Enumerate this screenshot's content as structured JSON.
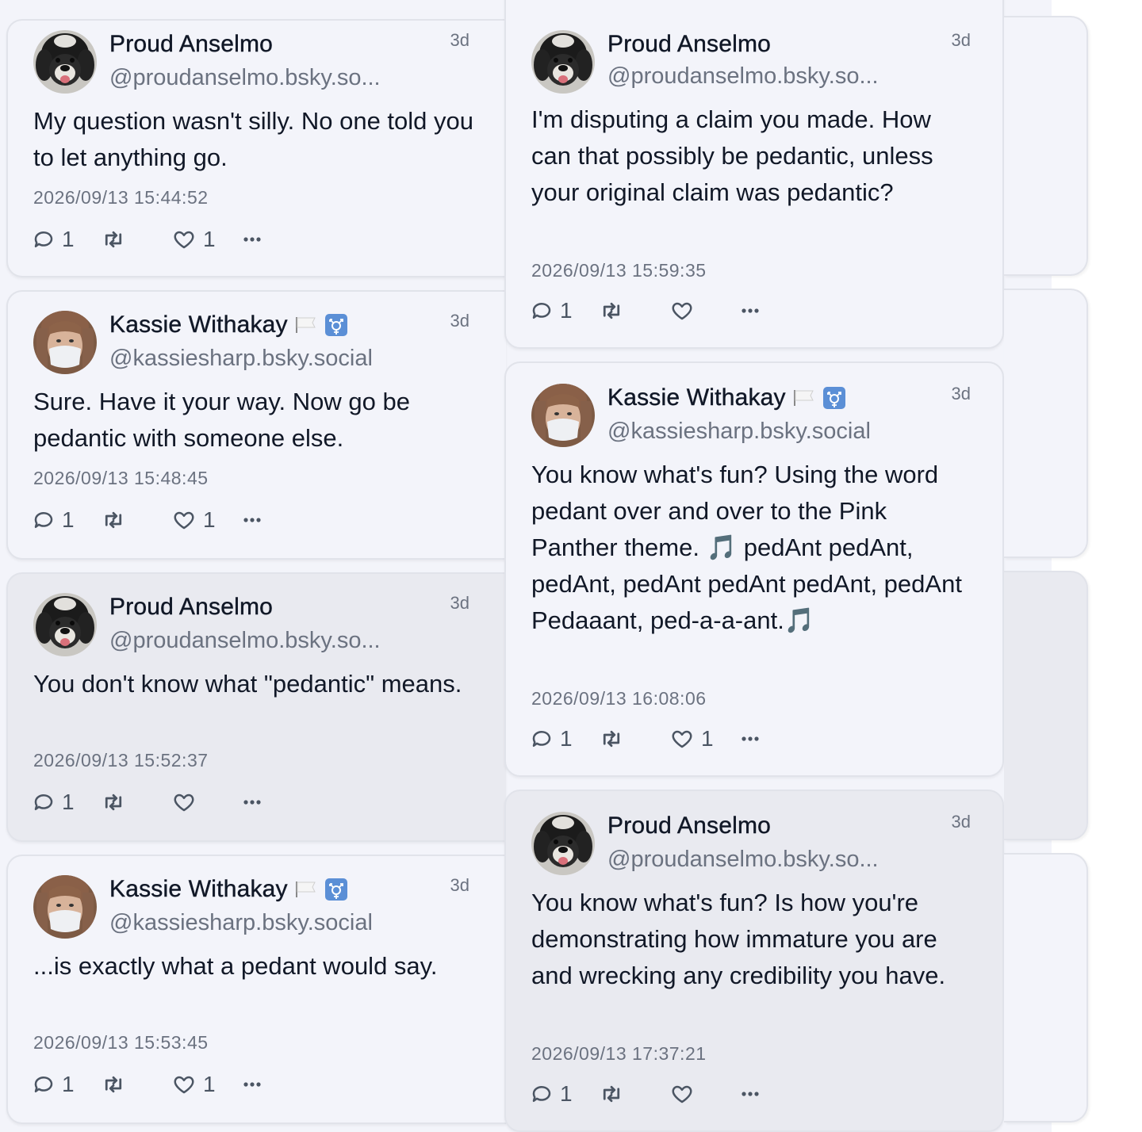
{
  "colors": {
    "background": "#f3f4fa",
    "card_border": "#e1e3ea",
    "highlighted_card": "#e9eaf0",
    "text": "#111827",
    "muted_text": "#6b7280"
  },
  "left_column": [
    {
      "name": "Proud Anselmo",
      "handle": "@proudanselmo.bsky.so...",
      "time": "3d",
      "text": "My question wasn't silly. No one told you to let anything go.",
      "timestamp": "2026/09/13 15:44:52",
      "replies": "1",
      "reposts": "",
      "likes": "1",
      "avatar": "dog-avatar",
      "highlighted": false
    },
    {
      "name": "Kassie Withakay",
      "handle": "@kassiesharp.bsky.social",
      "time": "3d",
      "text": "Sure. Have it your way. Now go be pedantic with someone else.",
      "timestamp": "2026/09/13 15:48:45",
      "replies": "1",
      "reposts": "",
      "likes": "1",
      "avatar": "masked-person-avatar",
      "highlighted": false
    },
    {
      "name": "Proud Anselmo",
      "handle": "@proudanselmo.bsky.so...",
      "time": "3d",
      "text": "You don't know what \"pedantic\" means.",
      "timestamp": "2026/09/13 15:52:37",
      "replies": "1",
      "reposts": "",
      "likes": "",
      "avatar": "dog-avatar",
      "highlighted": true
    },
    {
      "name": "Kassie Withakay",
      "handle": "@kassiesharp.bsky.social",
      "time": "3d",
      "text": "...is exactly what a pedant would say.",
      "timestamp": "2026/09/13 15:53:45",
      "replies": "1",
      "reposts": "",
      "likes": "1",
      "avatar": "masked-person-avatar",
      "highlighted": false
    }
  ],
  "middle_column": [
    {
      "name": "Proud Anselmo",
      "handle": "@proudanselmo.bsky.so...",
      "time": "3d",
      "text": "I'm disputing a claim you made. How can that possibly be pedantic, unless your original claim was pedantic?",
      "timestamp": "2026/09/13 15:59:35",
      "replies": "1",
      "reposts": "",
      "likes": "",
      "avatar": "dog-avatar",
      "highlighted": false
    },
    {
      "name": "Kassie Withakay",
      "handle": "@kassiesharp.bsky.social",
      "time": "3d",
      "text": "You know what's fun? Using the word pedant over and over to the Pink Panther theme. 🎵 pedAnt pedAnt, pedAnt, pedAnt pedAnt pedAnt, pedAnt Pedaaant, ped-a-a-ant.🎵",
      "timestamp": "2026/09/13 16:08:06",
      "replies": "1",
      "reposts": "",
      "likes": "1",
      "avatar": "masked-person-avatar",
      "highlighted": false
    },
    {
      "name": "Proud Anselmo",
      "handle": "@proudanselmo.bsky.so...",
      "time": "3d",
      "text": "You know what's fun? Is how you're demonstrating how immature you are and wrecking any credibility you have.",
      "timestamp": "2026/09/13 17:37:21",
      "replies": "1",
      "reposts": "",
      "likes": "",
      "avatar": "dog-avatar",
      "highlighted": true
    }
  ]
}
